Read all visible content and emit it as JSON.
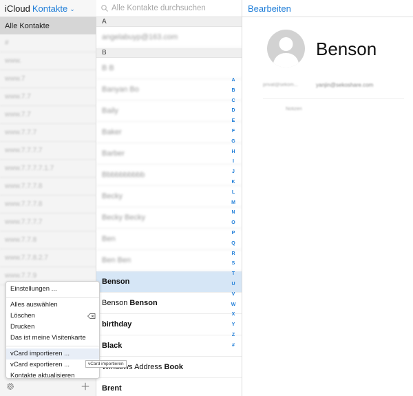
{
  "brand": {
    "app": "iCloud",
    "module": "Kontakte"
  },
  "groups": {
    "all": "Alle Kontakte",
    "items": [
      "#",
      "www.",
      "www.7",
      "www.7.7",
      "www.7.7",
      "www.7.7.7",
      "www.7.7.7.7",
      "www.7.7.7.7.1.7",
      "www.7.7.7.8",
      "www.7.7.7.8",
      "www.7.7.7.7",
      "www.7.7.8",
      "www.7.7.8.2.7",
      "www.7.7.9"
    ]
  },
  "menu": {
    "items": [
      "Einstellungen ...",
      "Alles auswählen",
      "Löschen",
      "Drucken",
      "Das ist meine Visitenkarte",
      "vCard importieren ...",
      "vCard exportieren ...",
      "Kontakte aktualisieren"
    ],
    "tooltip": "vCard importieren"
  },
  "search": {
    "placeholder": "Alle Kontakte durchsuchen"
  },
  "list": {
    "section_a": "A",
    "row_a1": "angelabuyp@163.com",
    "section_b": "B",
    "blurred": [
      "B B",
      "Banyan Bo",
      "Baily",
      "Baker",
      "Barber",
      "Bbbbbbbbbb",
      "Becky",
      "Becky Becky",
      "Ben",
      "Ben Ben"
    ],
    "selected": "Benson",
    "row_bb_first": "Benson",
    "row_bb_last": "Benson",
    "birthday": "birthday",
    "black": "Black",
    "wab_first": "Windows Address",
    "wab_last": "Book",
    "brent": "Brent"
  },
  "alphabet": [
    "A",
    "B",
    "C",
    "D",
    "E",
    "F",
    "G",
    "H",
    "I",
    "J",
    "K",
    "L",
    "M",
    "N",
    "O",
    "P",
    "Q",
    "R",
    "S",
    "T",
    "U",
    "V",
    "W",
    "X",
    "Y",
    "Z",
    "#"
  ],
  "detail": {
    "edit_label": "Bearbeiten",
    "name": "Benson",
    "email_label": "privat@sekom...",
    "email_value": "yanjin@sekoshare.com",
    "note_label": "Notizen"
  }
}
